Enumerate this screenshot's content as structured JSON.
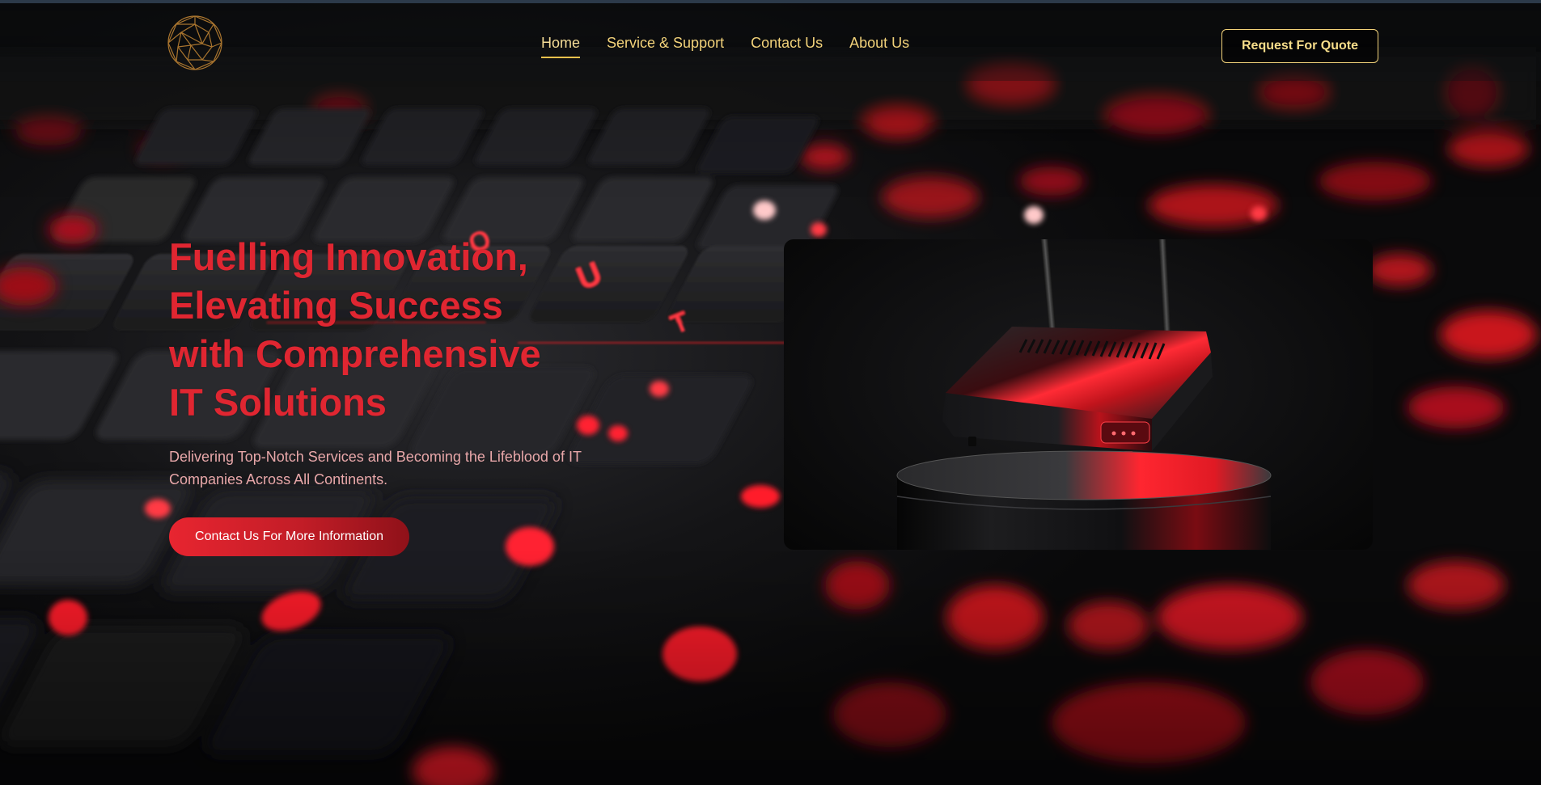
{
  "header": {
    "logo_name": "globe-mesh-logo",
    "nav": [
      {
        "label": "Home",
        "active": true
      },
      {
        "label": "Service & Support",
        "active": false
      },
      {
        "label": "Contact Us",
        "active": false
      },
      {
        "label": "About Us",
        "active": false
      }
    ],
    "cta_label": "Request For Quote"
  },
  "hero": {
    "title_lines": [
      "Fuelling Innovation,",
      "Elevating Success",
      "with Comprehensive",
      "IT Solutions"
    ],
    "subtitle": "Delivering Top-Notch Services and Becoming the Lifeblood of IT Companies Across All Continents.",
    "cta_label": "Contact Us For More Information",
    "image_name": "router-on-pedestal-image"
  },
  "colors": {
    "accent_red": "#e02631",
    "gold": "#f2d27a",
    "background": "#0b0b0d"
  }
}
